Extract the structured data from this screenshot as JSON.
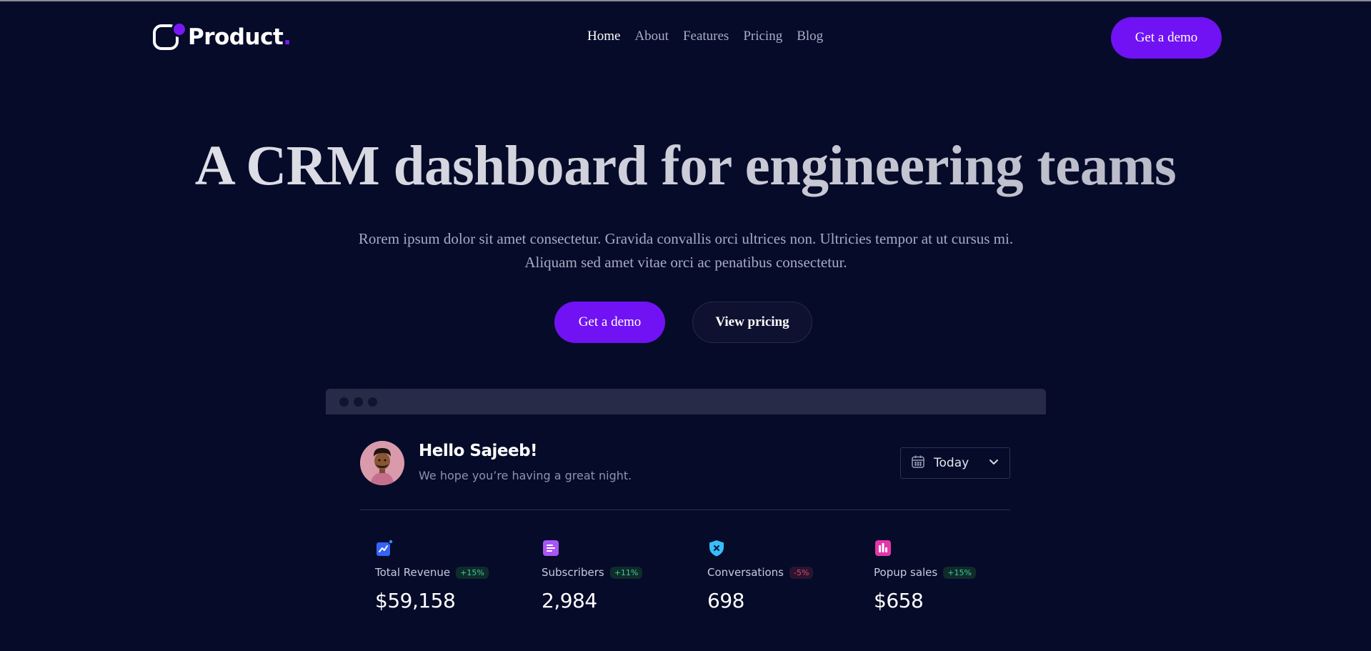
{
  "header": {
    "logo_text": "Product",
    "logo_period": ".",
    "nav": [
      {
        "label": "Home",
        "active": true
      },
      {
        "label": "About",
        "active": false
      },
      {
        "label": "Features",
        "active": false
      },
      {
        "label": "Pricing",
        "active": false
      },
      {
        "label": "Blog",
        "active": false
      }
    ],
    "cta_label": "Get a demo"
  },
  "hero": {
    "title": "A CRM dashboard for engineering teams",
    "subtitle_line1": "Rorem ipsum dolor sit amet consectetur. Gravida convallis orci ultrices non. Ultricies tempor at ut cursus mi.",
    "subtitle_line2": "Aliquam sed amet vitae orci ac penatibus consectetur.",
    "primary_button": "Get a demo",
    "secondary_button": "View pricing"
  },
  "dashboard": {
    "greeting": "Hello Sajeeb!",
    "greeting_sub": "We hope you’re having a great night.",
    "date_filter": "Today",
    "stats": [
      {
        "label": "Total Revenue",
        "change": "+15%",
        "value": "$59,158",
        "trend": "positive",
        "icon": "revenue-chart-icon",
        "color": "#3563f5"
      },
      {
        "label": "Subscribers",
        "change": "+11%",
        "value": "2,984",
        "trend": "positive",
        "icon": "subscribers-list-icon",
        "color": "#a855f7"
      },
      {
        "label": "Conversations",
        "change": "-5%",
        "value": "698",
        "trend": "negative",
        "icon": "conversations-shield-icon",
        "color": "#38bdf8"
      },
      {
        "label": "Popup sales",
        "change": "+15%",
        "value": "$658",
        "trend": "positive",
        "icon": "popup-sales-bars-icon",
        "color": "#e535ab"
      }
    ]
  },
  "colors": {
    "background": "#060b29",
    "accent": "#7012f3",
    "positive": "#3ecf8e",
    "negative": "#e04866"
  }
}
